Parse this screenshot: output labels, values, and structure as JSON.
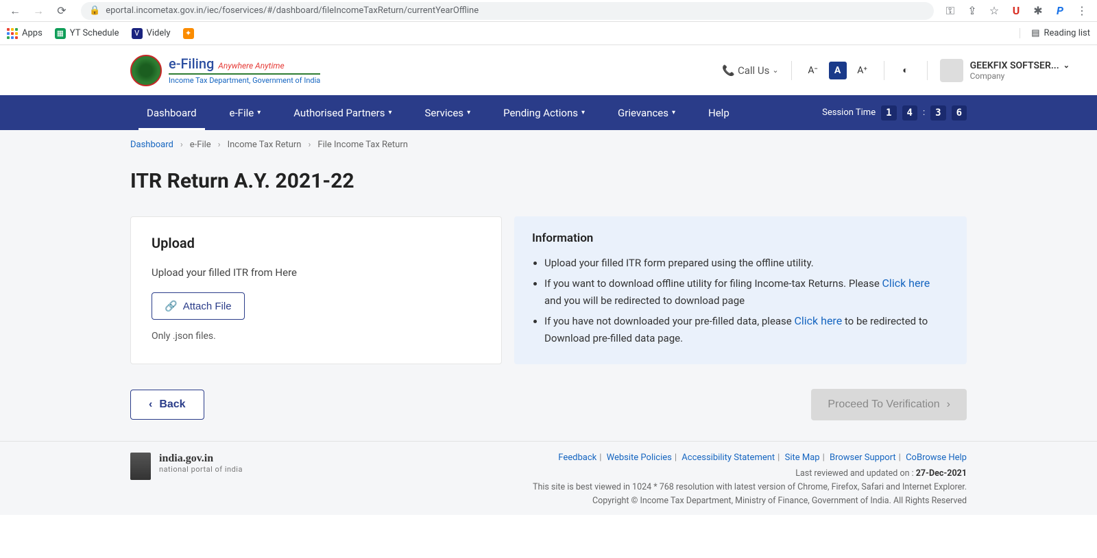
{
  "browser": {
    "url": "eportal.incometax.gov.in/iec/foservices/#/dashboard/fileIncomeTaxReturn/currentYearOffline",
    "bookmarks": {
      "apps": "Apps",
      "yt": "YT Schedule",
      "videly": "Videly"
    },
    "reading_list": "Reading list"
  },
  "header": {
    "brand": "e-Filing",
    "tagline": "Anywhere Anytime",
    "dept": "Income Tax Department, Government of India",
    "callus": "Call Us",
    "font_minus": "A⁻",
    "font_box": "A",
    "font_plus": "A⁺",
    "user_name": "GEEKFIX SOFTSER...",
    "user_type": "Company"
  },
  "nav": {
    "items": [
      "Dashboard",
      "e-File",
      "Authorised Partners",
      "Services",
      "Pending Actions",
      "Grievances",
      "Help"
    ],
    "session_label": "Session Time",
    "session_d1": "1",
    "session_d2": "4",
    "session_d3": "3",
    "session_d4": "6"
  },
  "breadcrumb": [
    "Dashboard",
    "e-File",
    "Income Tax Return",
    "File Income Tax Return"
  ],
  "page_title": "ITR Return A.Y. 2021-22",
  "upload": {
    "heading": "Upload",
    "sub": "Upload your filled ITR from Here",
    "attach": "Attach File",
    "hint": "Only .json files."
  },
  "info": {
    "heading": "Information",
    "li1": "Upload your filled ITR form prepared using the offline utility.",
    "li2a": "If you want to download offline utility for filing Income-tax Returns. Please ",
    "li2link": "Click here",
    "li2b": " and you will be redirected to download page",
    "li3a": "If you have not downloaded your pre-filled data, please ",
    "li3link": "Click here",
    "li3b": " to be redirected to Download pre-filled data page."
  },
  "actions": {
    "back": "Back",
    "proceed": "Proceed To Verification"
  },
  "footer": {
    "portal": "india.gov.in",
    "portal_sub": "national portal of india",
    "links": [
      "Feedback",
      "Website Policies",
      "Accessibility Statement",
      "Site Map",
      "Browser Support",
      "CoBrowse Help"
    ],
    "reviewed_label": "Last reviewed and updated on : ",
    "reviewed_date": "27-Dec-2021",
    "bestview": "This site is best viewed in 1024 * 768 resolution with latest version of Chrome, Firefox, Safari and Internet Explorer.",
    "copyright": "Copyright © Income Tax Department, Ministry of Finance, Government of India. All Rights Reserved"
  }
}
